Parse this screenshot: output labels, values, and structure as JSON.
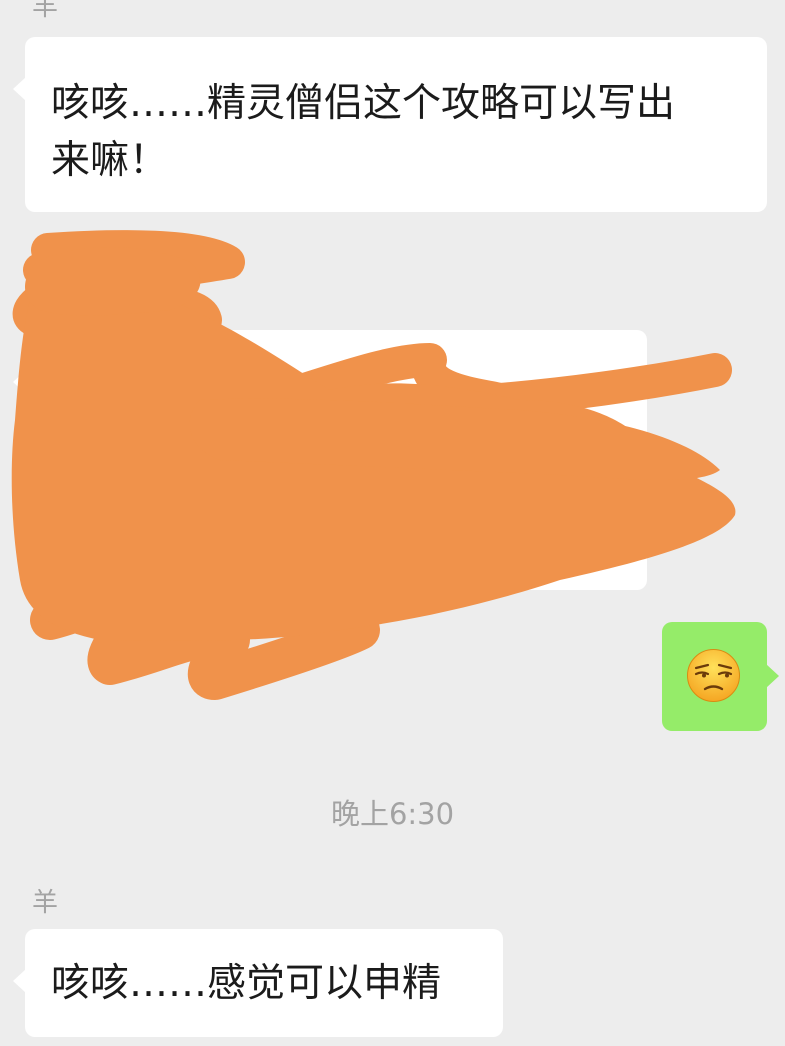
{
  "messages": [
    {
      "sender": "羊",
      "text": "咳咳……精灵僧侣这个攻略可以写出\n来嘛！"
    },
    {
      "sender": "羊",
      "text": "咳咳……感觉可以申精"
    }
  ],
  "outgoing": {
    "emoji": "unamused-face-icon"
  },
  "timestamp": "晚上6:30",
  "colors": {
    "background": "#ededed",
    "incoming_bubble": "#ffffff",
    "outgoing_bubble": "#95ec69",
    "redaction": "#f0924b",
    "muted_text": "#a3a3a3"
  }
}
